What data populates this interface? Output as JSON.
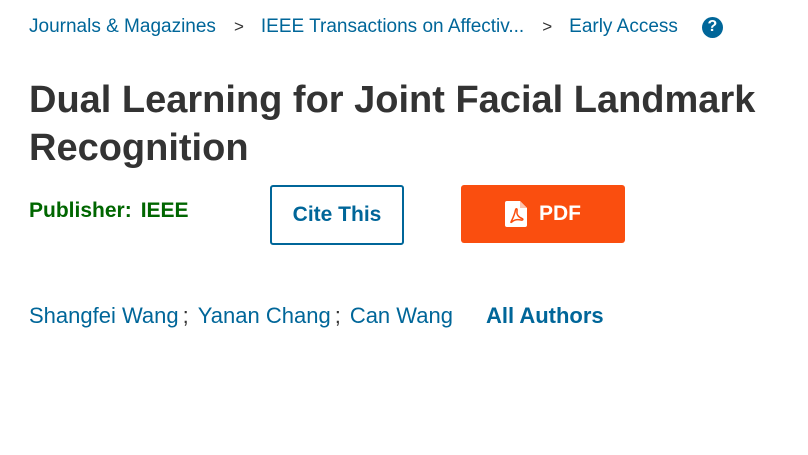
{
  "breadcrumb": {
    "items": [
      {
        "label": "Journals & Magazines"
      },
      {
        "label": "IEEE Transactions on Affectiv..."
      },
      {
        "label": "Early Access"
      }
    ],
    "separator": ">",
    "help_icon": "question-circle-icon",
    "help_symbol": "?"
  },
  "article": {
    "title_line1": "Dual Learning for Joint Facial Landmark",
    "title_line2": "Recognition"
  },
  "publisher": {
    "label": "Publisher:",
    "name": "IEEE"
  },
  "actions": {
    "cite_label": "Cite This",
    "pdf_label": "PDF",
    "pdf_icon": "pdf-file-icon"
  },
  "authors": {
    "list": [
      {
        "name": "Shangfei Wang"
      },
      {
        "name": "Yanan Chang"
      },
      {
        "name": "Can Wang"
      }
    ],
    "separator": ";",
    "all_authors_label": "All Authors"
  },
  "colors": {
    "link": "#006699",
    "publisher": "#006600",
    "pdf_button": "#fa4e0f",
    "text": "#333333"
  }
}
